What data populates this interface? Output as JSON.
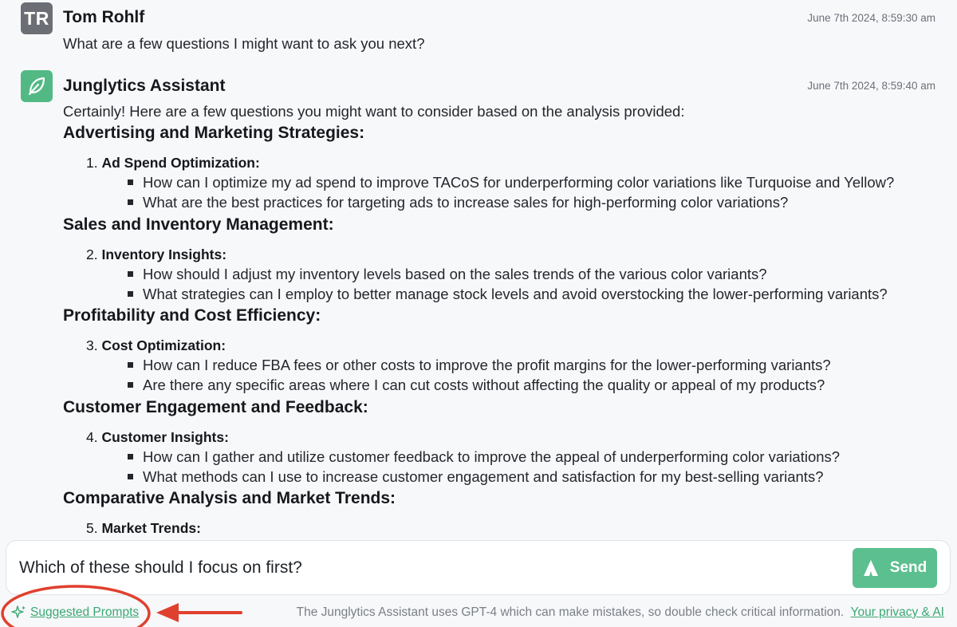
{
  "messages": {
    "user": {
      "avatar_initials": "TR",
      "name": "Tom Rohlf",
      "timestamp": "June 7th 2024, 8:59:30 am",
      "text": "What are a few questions I might want to ask you next?"
    },
    "assistant": {
      "name": "Junglytics Assistant",
      "timestamp": "June 7th 2024, 8:59:40 am",
      "intro": "Certainly! Here are a few questions you might want to consider based on the analysis provided:",
      "sections": [
        {
          "heading": "Advertising and Marketing Strategies:",
          "item_number": "1.",
          "item_title": "Ad Spend Optimization:",
          "bullets": [
            "How can I optimize my ad spend to improve TACoS for underperforming color variations like Turquoise and Yellow?",
            "What are the best practices for targeting ads to increase sales for high-performing color variations?"
          ]
        },
        {
          "heading": "Sales and Inventory Management:",
          "item_number": "2.",
          "item_title": "Inventory Insights:",
          "bullets": [
            "How should I adjust my inventory levels based on the sales trends of the various color variants?",
            "What strategies can I employ to better manage stock levels and avoid overstocking the lower-performing variants?"
          ]
        },
        {
          "heading": "Profitability and Cost Efficiency:",
          "item_number": "3.",
          "item_title": "Cost Optimization:",
          "bullets": [
            "How can I reduce FBA fees or other costs to improve the profit margins for the lower-performing variants?",
            "Are there any specific areas where I can cut costs without affecting the quality or appeal of my products?"
          ]
        },
        {
          "heading": "Customer Engagement and Feedback:",
          "item_number": "4.",
          "item_title": "Customer Insights:",
          "bullets": [
            "How can I gather and utilize customer feedback to improve the appeal of underperforming color variations?",
            "What methods can I use to increase customer engagement and satisfaction for my best-selling variants?"
          ]
        },
        {
          "heading": "Comparative Analysis and Market Trends:",
          "item_number": "5.",
          "item_title": "Market Trends:",
          "bullets": []
        }
      ]
    }
  },
  "composer": {
    "value": "Which of these should I focus on first?",
    "send_label": "Send"
  },
  "footer": {
    "suggested_prompts_label": "Suggested Prompts",
    "disclaimer": "The Junglytics Assistant uses GPT-4 which can make mistakes, so double check critical information.",
    "privacy_link": "Your privacy & AI"
  },
  "colors": {
    "brand_green": "#52b985",
    "send_green": "#5cbf8f",
    "annotation_red": "#e0402e"
  },
  "icons": [
    "leaf-icon",
    "sparkle-icon",
    "send-arrow-icon"
  ]
}
